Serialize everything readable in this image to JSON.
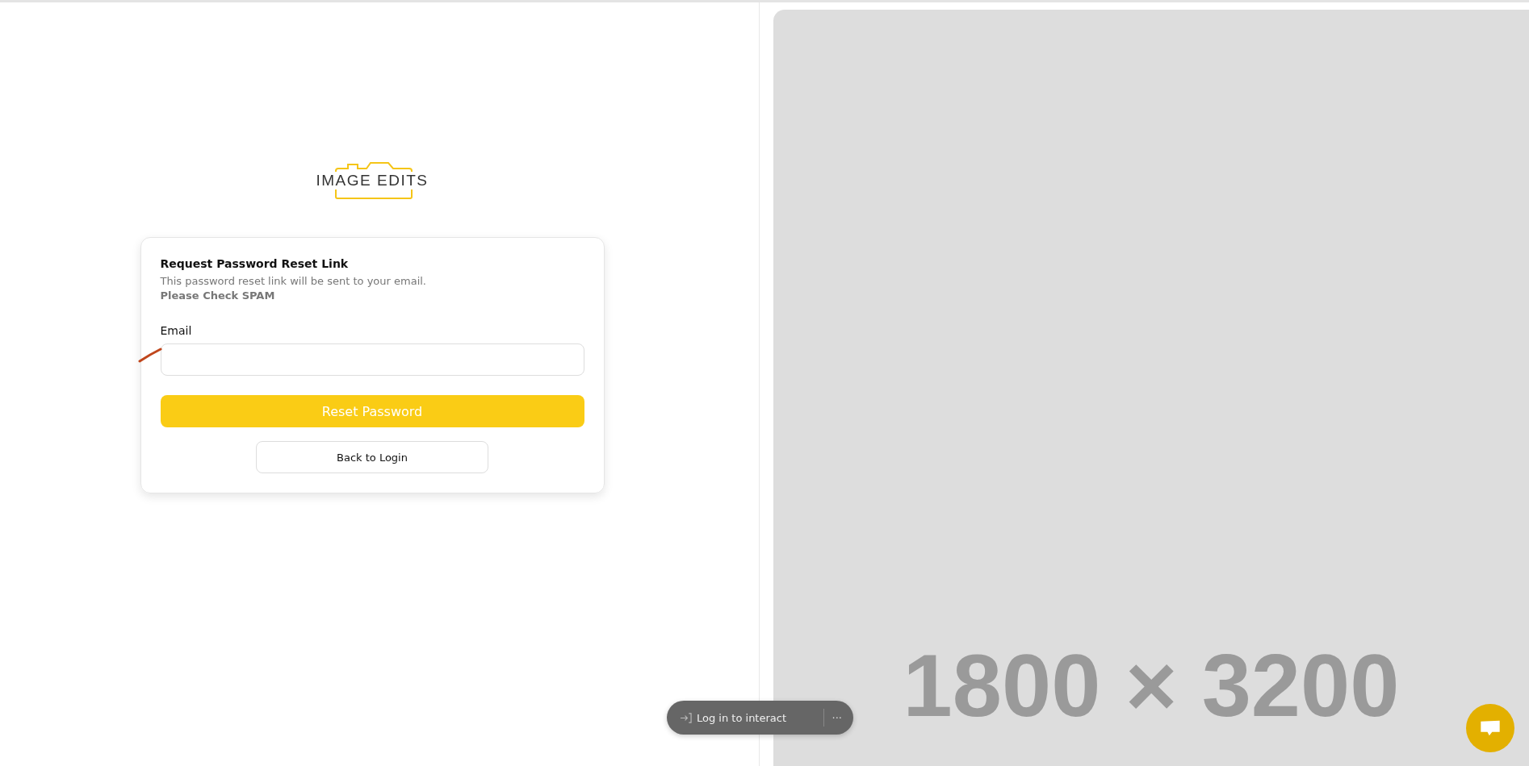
{
  "logo": {
    "text": "IMAGE EDITS"
  },
  "card": {
    "title": "Request Password Reset Link",
    "description": "This password reset link will be sent to your email.",
    "notice": "Please Check SPAM",
    "email": {
      "label": "Email"
    },
    "submit_button": "Reset Password",
    "back_button": "Back to Login"
  },
  "preview_panel": {
    "text": "1800 × 3200"
  },
  "interaction_bar": {
    "label": "Log in to interact",
    "more": "···"
  }
}
